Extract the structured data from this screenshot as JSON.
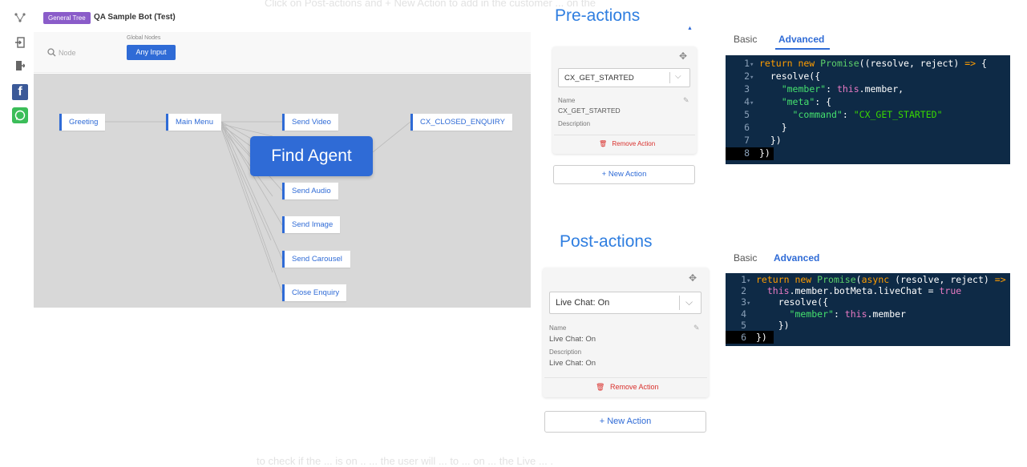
{
  "background_text": {
    "top": "Click on Post-actions and + New Action to add in the customer ... on the",
    "bottom": "to check if the ... is on .. ...   the user will  ... to ... on ... the Live ... ."
  },
  "tree": {
    "badge": "General Tree",
    "title": "QA Sample Bot (Test)",
    "search_placeholder": "Node",
    "global_nodes_label": "Global Nodes",
    "any_input": "Any Input",
    "nodes": {
      "greeting": "Greeting",
      "main_menu": "Main Menu",
      "send_video": "Send Video",
      "cx_closed": "CX_CLOSED_ENQUIRY",
      "send_audio": "Send Audio",
      "send_image": "Send Image",
      "send_carousel": "Send Carousel",
      "close_enquiry": "Close Enquiry"
    },
    "find_agent": "Find Agent"
  },
  "pre_actions": {
    "title": "Pre-actions",
    "selected": "CX_GET_STARTED",
    "name_label": "Name",
    "name_value": "CX_GET_STARTED",
    "description_label": "Description",
    "remove": "Remove Action",
    "new_action": "+ New Action"
  },
  "post_actions": {
    "title": "Post-actions",
    "selected": "Live Chat: On",
    "name_label": "Name",
    "name_value": "Live Chat: On",
    "description_label": "Description",
    "description_value": "Live Chat: On",
    "remove": "Remove Action",
    "new_action": "+ New Action"
  },
  "tabs_top": {
    "basic": "Basic",
    "advanced": "Advanced"
  },
  "tabs_bottom": {
    "basic": "Basic",
    "advanced": "Advanced"
  },
  "colors": {
    "accent": "#2f6bd6",
    "code_bg": "#0e2a46",
    "remove": "#d9302c",
    "badge": "#8a5cc9"
  },
  "icons": [
    "tree-icon",
    "import-icon",
    "export-icon",
    "facebook-icon",
    "whatsapp-icon",
    "search-icon",
    "drag-handle-icon",
    "edit-icon",
    "trash-icon",
    "chevron-down-icon"
  ]
}
